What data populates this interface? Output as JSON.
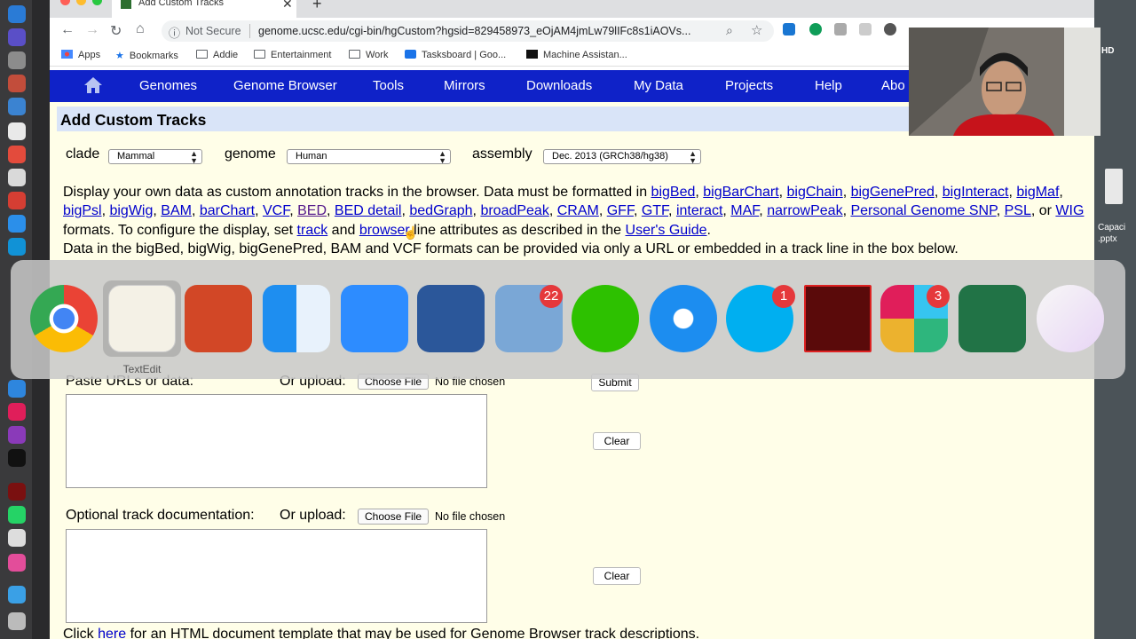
{
  "browser": {
    "tab_title": "Add Custom Tracks",
    "security_label": "Not Secure",
    "url": "genome.ucsc.edu/cgi-bin/hgCustom?hgsid=829458973_eOjAM4jmLw79lIFc8s1iAOVs...",
    "bookmarks": [
      "Apps",
      "Bookmarks",
      "Addie",
      "Entertainment",
      "Work",
      "Tasksboard | Goo...",
      "Machine Assistan..."
    ]
  },
  "nav": {
    "items": [
      "Genomes",
      "Genome Browser",
      "Tools",
      "Mirrors",
      "Downloads",
      "My Data",
      "Projects",
      "Help",
      "Abo"
    ]
  },
  "page": {
    "title": "Add Custom Tracks",
    "clade_label": "clade",
    "clade_value": "Mammal",
    "genome_label": "genome",
    "genome_value": "Human",
    "assembly_label": "assembly",
    "assembly_value": "Dec. 2013 (GRCh38/hg38)",
    "intro_start": "Display your own data as custom annotation tracks in the browser. Data must be formatted in ",
    "formats": [
      "bigBed",
      "bigBarChart",
      "bigChain",
      "bigGenePred",
      "bigInteract",
      "bigMaf",
      "bigPsl",
      "bigWig",
      "BAM",
      "barChart",
      "VCF",
      "BED",
      "BED detail",
      "bedGraph",
      "broadPeak",
      "CRAM",
      "GFF",
      "GTF",
      "interact",
      "MAF",
      "narrowPeak",
      "Personal Genome SNP",
      "PSL"
    ],
    "or_text": ", or ",
    "wig": "WIG",
    "configure_text": " formats. To configure the display, set ",
    "track_link": "track",
    "and_text": " and ",
    "browser_link": "browser",
    "attributes_text": " line attributes as described in the ",
    "guide_link": "User's Guide",
    "period": ".",
    "intro_second": "Data in the bigBed, bigWig, bigGenePred, BAM and VCF formats can be provided via only a URL or embedded in a track line in the box below.",
    "paste_label": "Paste URLs or data:",
    "or_upload_label": "Or upload:",
    "choose_file": "Choose File",
    "no_file": "No file chosen",
    "submit": "Submit",
    "clear": "Clear",
    "doc_label": "Optional track documentation:",
    "doc_or_upload": "Or upload:",
    "bottom_click": "Click ",
    "bottom_here": "here",
    "bottom_rest": " for an HTML document template that may be used for Genome Browser track descriptions."
  },
  "switcher": {
    "selected_label": "TextEdit",
    "apps": [
      "chrome-icon",
      "textedit-icon",
      "powerpoint-icon",
      "finder-icon",
      "zoom-icon",
      "word-icon",
      "mail-icon",
      "wechat-icon",
      "safari-icon",
      "skype-icon",
      "acrobat-icon",
      "slack-icon",
      "excel-icon",
      "itunes-icon"
    ],
    "badges": {
      "mail": "22",
      "skype": "1",
      "slack": "3"
    }
  },
  "desktop": {
    "hd_label": "HD",
    "file_label_1": "Capaci",
    "file_label_2": ".pptx"
  },
  "colors": {
    "nav_blue": "#0f22c8",
    "page_bg": "#fffee8",
    "title_bg": "#d9e4f8",
    "link": "#0000cc"
  }
}
